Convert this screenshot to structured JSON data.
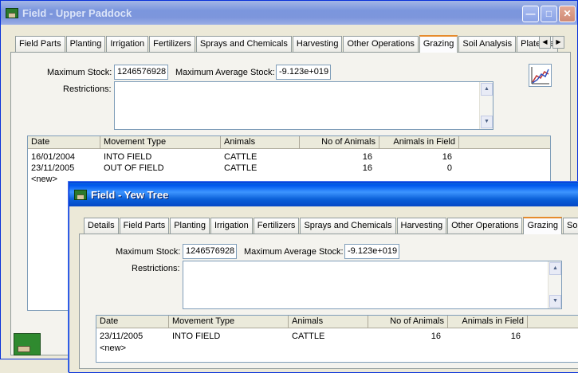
{
  "back_window": {
    "title": "Field - Upper Paddock",
    "tabs": [
      "Field Parts",
      "Planting",
      "Irrigation",
      "Fertilizers",
      "Sprays and Chemicals",
      "Harvesting",
      "Other Operations",
      "Grazing",
      "Soil Analysis",
      "Plate Re"
    ],
    "active_tab": "Grazing",
    "max_stock_label": "Maximum Stock:",
    "max_stock_value": "1246576928",
    "max_avg_stock_label": "Maximum Average Stock:",
    "max_avg_stock_value": "-9.123e+019",
    "restrictions_label": "Restrictions:",
    "grid": {
      "columns": [
        "Date",
        "Movement Type",
        "Animals",
        "No of Animals",
        "Animals in Field"
      ],
      "rows": [
        [
          "16/01/2004",
          "INTO FIELD",
          "CATTLE",
          "16",
          "16"
        ],
        [
          "23/11/2005",
          "OUT OF FIELD",
          "CATTLE",
          "16",
          "0"
        ]
      ],
      "new_row": "<new>"
    }
  },
  "front_window": {
    "title": "Field - Yew Tree",
    "tabs": [
      "Details",
      "Field Parts",
      "Planting",
      "Irrigation",
      "Fertilizers",
      "Sprays and Chemicals",
      "Harvesting",
      "Other Operations",
      "Grazing",
      "Soil An"
    ],
    "active_tab": "Grazing",
    "max_stock_label": "Maximum Stock:",
    "max_stock_value": "1246576928",
    "max_avg_stock_label": "Maximum Average Stock:",
    "max_avg_stock_value": "-9.123e+019",
    "restrictions_label": "Restrictions:",
    "grid": {
      "columns": [
        "Date",
        "Movement Type",
        "Animals",
        "No of Animals",
        "Animals in Field"
      ],
      "rows": [
        [
          "23/11/2005",
          "INTO FIELD",
          "CATTLE",
          "16",
          "16"
        ]
      ],
      "new_row": "<new>"
    }
  },
  "colors": {
    "titlebar_active": "#0058ee",
    "titlebar_inactive": "#7b96dd",
    "window_bg": "#ece9d8",
    "tab_active_accent": "#e68b2c"
  },
  "icons": [
    "field-app-icon",
    "minimize-icon",
    "maximize-icon",
    "close-icon",
    "tab-scroll-left-icon",
    "tab-scroll-right-icon",
    "graph-icon",
    "scroll-up-icon",
    "scroll-down-icon"
  ]
}
